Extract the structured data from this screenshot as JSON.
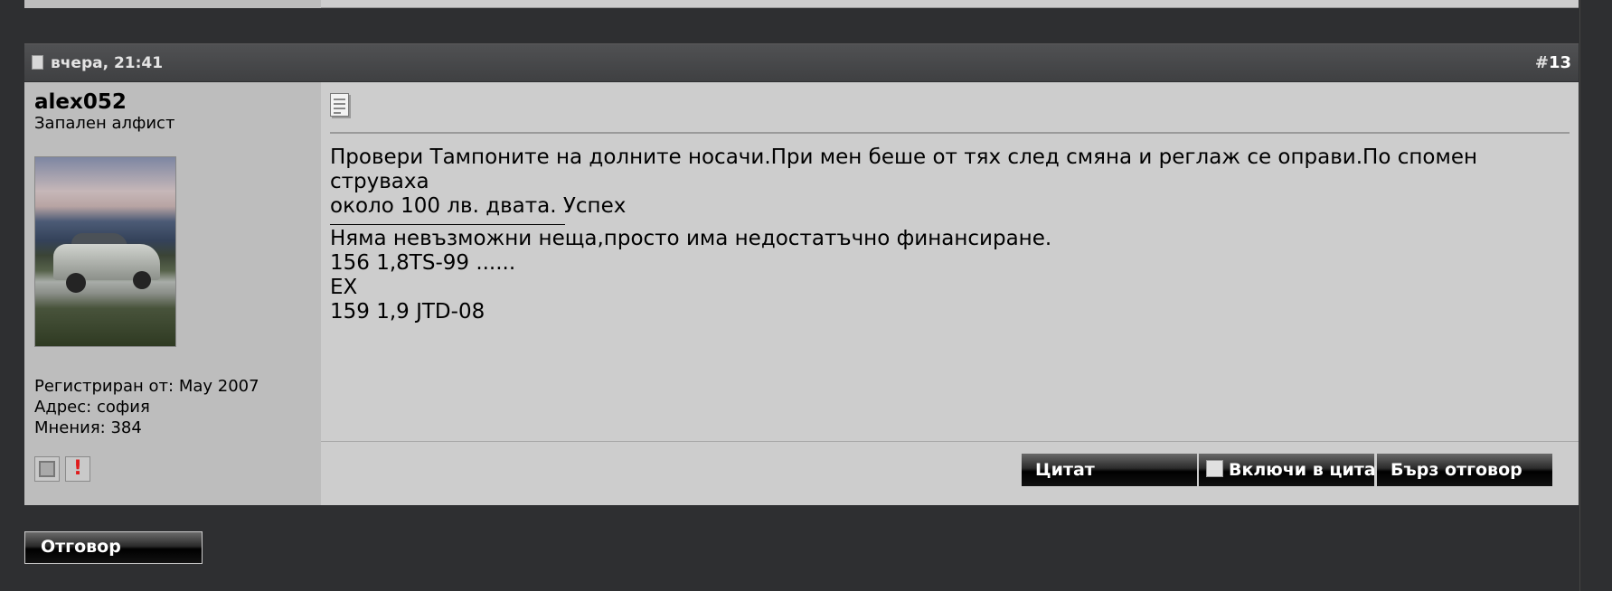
{
  "post": {
    "date": "вчера, 21:41",
    "number": "13",
    "number_prefix": "#",
    "author": {
      "username": "alex052",
      "title": "Запален алфист",
      "registered": "Регистриран от: May 2007",
      "location": "Адрес: софия",
      "posts": "Мнения: 384"
    },
    "message": {
      "line1": "Провери Тампоните на долните носачи.При мен беше от тях след смяна и реглаж се оправи.По спомен струваха",
      "line2": "около 100 лв. двата. Успех"
    },
    "signature": {
      "line1": "Няма невъзможни неща,просто има недостатъчно финансиране.",
      "line2": "156 1,8TS-99 ......",
      "line3": "EX",
      "line4": "159 1,9 JTD-08"
    },
    "buttons": {
      "quote": "Цитат",
      "multiquote": "Включи в цитат",
      "quick_reply": "Бърз отговор"
    }
  },
  "reply_button": "Отговор",
  "icons": {
    "post_icon": "document-icon",
    "message_icon": "message-page-icon",
    "report": "report-exclamation-icon",
    "profile": "profile-square-icon"
  }
}
